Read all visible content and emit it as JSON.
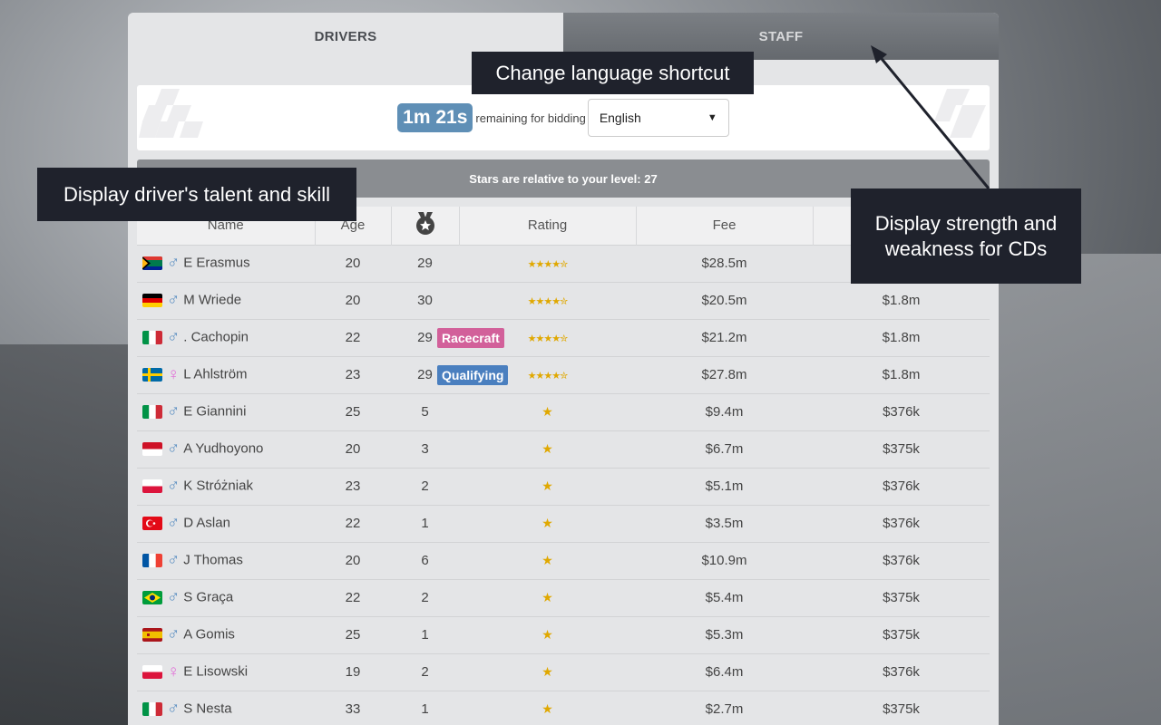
{
  "tabs": {
    "drivers": "DRIVERS",
    "staff": "STAFF"
  },
  "bidding": {
    "timer": "1m 21s",
    "remaining_text": "remaining for bidding",
    "language_selected": "English"
  },
  "stars_info": "Stars are relative to your level: 27",
  "columns": {
    "name": "Name",
    "age": "Age",
    "rating": "Rating",
    "fee": "Fee"
  },
  "colors": {
    "racecraft": "#d2609a",
    "qualifying": "#4a7fbf",
    "timer": "#5f8fb6",
    "star": "#e0a800"
  },
  "drivers": [
    {
      "nat": "ZA",
      "gender": "♂",
      "name": "E Erasmus",
      "age": "20",
      "talent": "29",
      "cd": "",
      "rating": "★★★★✮",
      "fee": "$28.5m",
      "salary": ""
    },
    {
      "nat": "DE",
      "gender": "♂",
      "name": "M Wriede",
      "age": "20",
      "talent": "30",
      "cd": "",
      "rating": "★★★★✮",
      "fee": "$20.5m",
      "salary": "$1.8m"
    },
    {
      "nat": "IT",
      "gender": "♂",
      "name": ". Cachopin",
      "age": "22",
      "talent": "29",
      "cd": "Racecraft",
      "rating": "★★★★✮",
      "fee": "$21.2m",
      "salary": "$1.8m"
    },
    {
      "nat": "SE",
      "gender": "♀",
      "name": "L Ahlström",
      "age": "23",
      "talent": "29",
      "cd": "Qualifying",
      "rating": "★★★★✮",
      "fee": "$27.8m",
      "salary": "$1.8m"
    },
    {
      "nat": "IT",
      "gender": "♂",
      "name": "E Giannini",
      "age": "25",
      "talent": "5",
      "cd": "",
      "rating": "★",
      "fee": "$9.4m",
      "salary": "$376k"
    },
    {
      "nat": "ID",
      "gender": "♂",
      "name": "A Yudhoyono",
      "age": "20",
      "talent": "3",
      "cd": "",
      "rating": "★",
      "fee": "$6.7m",
      "salary": "$375k"
    },
    {
      "nat": "PL",
      "gender": "♂",
      "name": "K Stróżniak",
      "age": "23",
      "talent": "2",
      "cd": "",
      "rating": "★",
      "fee": "$5.1m",
      "salary": "$376k"
    },
    {
      "nat": "TR",
      "gender": "♂",
      "name": "D Aslan",
      "age": "22",
      "talent": "1",
      "cd": "",
      "rating": "★",
      "fee": "$3.5m",
      "salary": "$376k"
    },
    {
      "nat": "FR",
      "gender": "♂",
      "name": "J Thomas",
      "age": "20",
      "talent": "6",
      "cd": "",
      "rating": "★",
      "fee": "$10.9m",
      "salary": "$376k"
    },
    {
      "nat": "BR",
      "gender": "♂",
      "name": "S Graça",
      "age": "22",
      "talent": "2",
      "cd": "",
      "rating": "★",
      "fee": "$5.4m",
      "salary": "$375k"
    },
    {
      "nat": "ES",
      "gender": "♂",
      "name": "A Gomis",
      "age": "25",
      "talent": "1",
      "cd": "",
      "rating": "★",
      "fee": "$5.3m",
      "salary": "$375k"
    },
    {
      "nat": "PL",
      "gender": "♀",
      "name": "E Lisowski",
      "age": "19",
      "talent": "2",
      "cd": "",
      "rating": "★",
      "fee": "$6.4m",
      "salary": "$376k"
    },
    {
      "nat": "IT",
      "gender": "♂",
      "name": "S Nesta",
      "age": "33",
      "talent": "1",
      "cd": "",
      "rating": "★",
      "fee": "$2.7m",
      "salary": "$375k"
    }
  ],
  "tooltips": {
    "language": "Change language shortcut",
    "talent": "Display driver's talent and skill",
    "cds": "Display strength and weakness for CDs"
  }
}
